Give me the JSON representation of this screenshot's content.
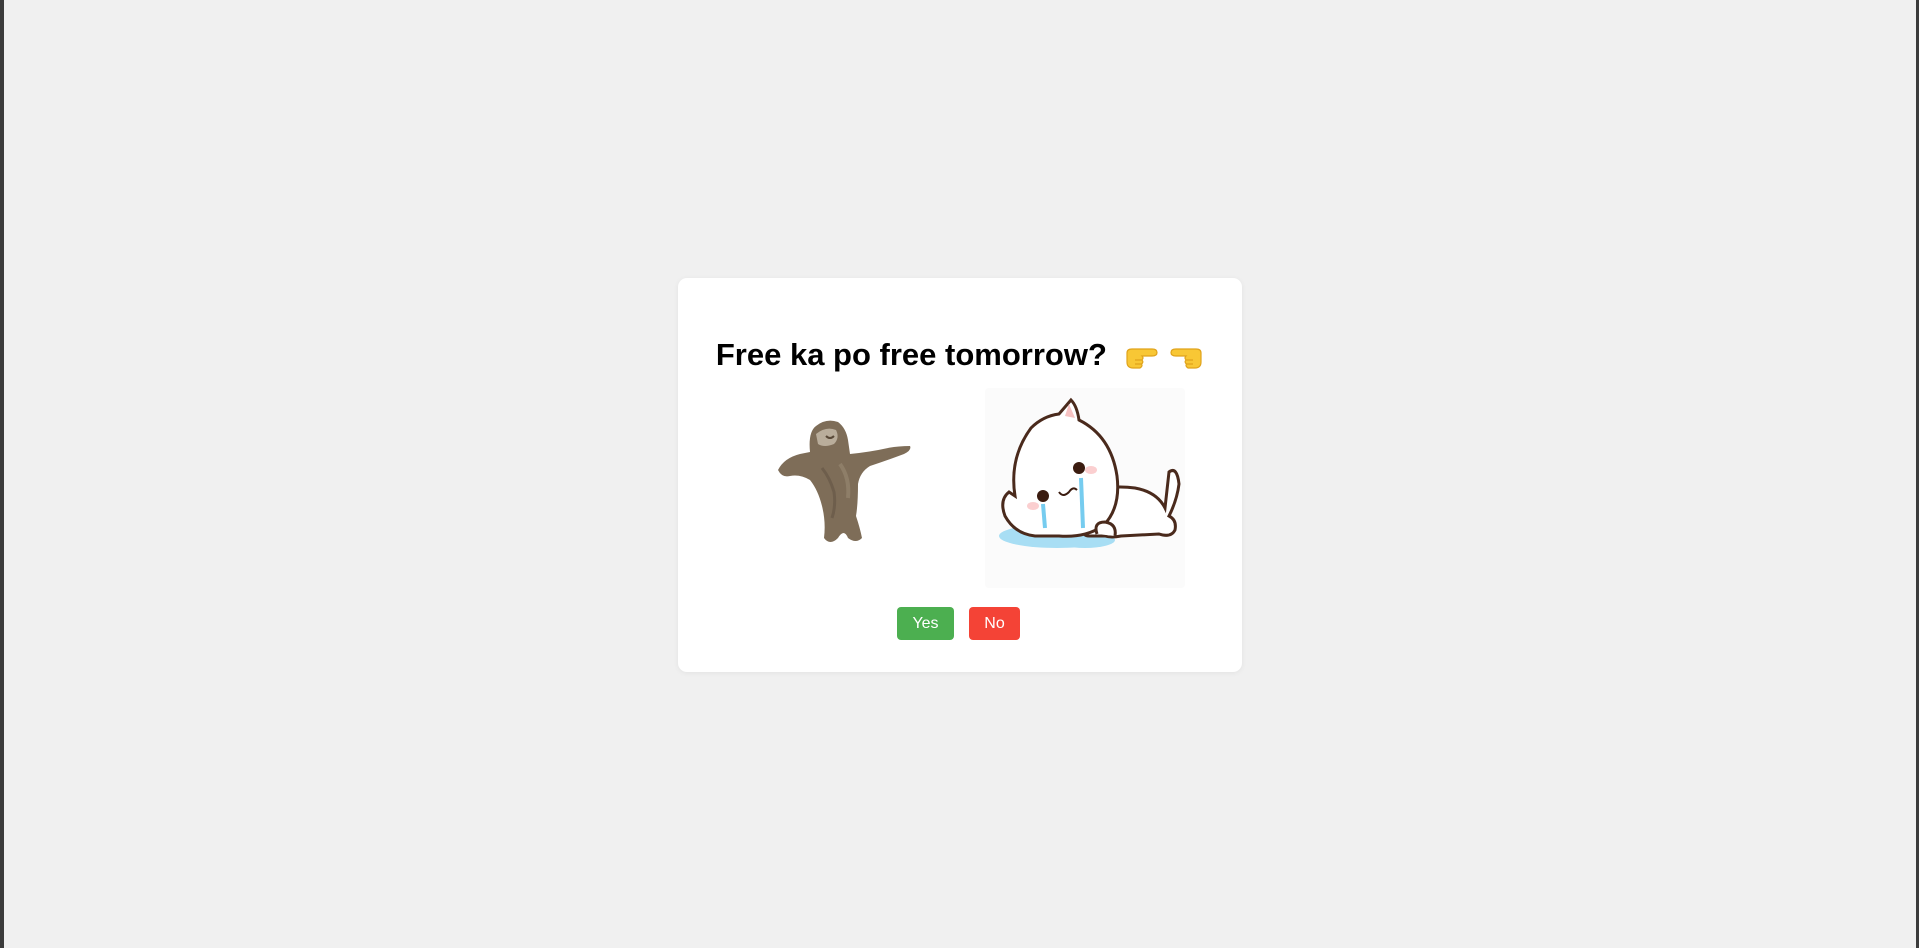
{
  "prompt": {
    "question": "Free ka po free tomorrow?",
    "emoji_icons": [
      "pointing-right-hand-icon",
      "pointing-left-hand-icon"
    ]
  },
  "images": {
    "left": "dancing-cat-image",
    "right": "crying-cat-image"
  },
  "buttons": {
    "yes_label": "Yes",
    "no_label": "No"
  },
  "colors": {
    "background": "#f0f0f0",
    "card": "#ffffff",
    "yes": "#4caf50",
    "no": "#f44336"
  }
}
